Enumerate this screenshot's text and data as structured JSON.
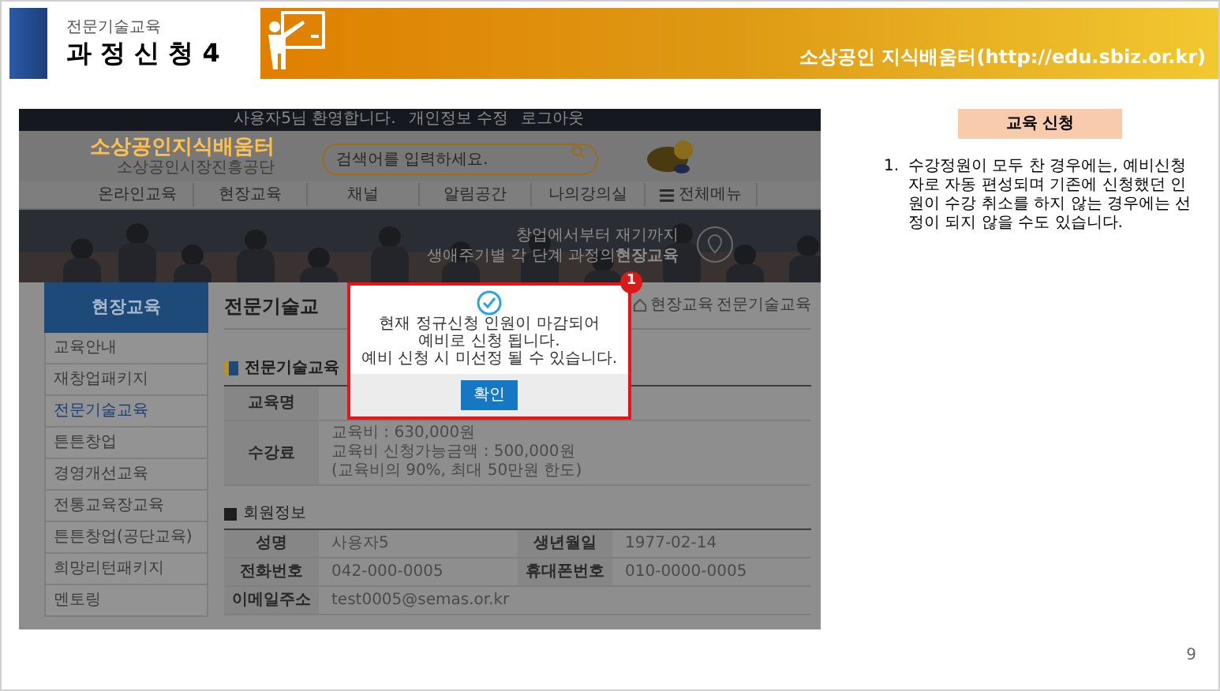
{
  "slide": {
    "subtitle": "전문기술교육",
    "title": "과 정 신 청 4",
    "site": "소상공인 지식배움터(http://edu.sbiz.or.kr)",
    "page_number": "9"
  },
  "screenshot": {
    "top_links": [
      "사용자5님 환영합니다.",
      "개인정보 수정",
      "로그아웃"
    ],
    "logo": "소상공인지식배움터",
    "logo_sub": "소상공인시장진흥공단",
    "search": {
      "placeholder": "검색어를 입력하세요."
    },
    "nav": [
      {
        "label": "온라인교육",
        "kind": "link"
      },
      {
        "label": "현장교육",
        "kind": "link"
      },
      {
        "label": "채널",
        "kind": "link"
      },
      {
        "label": "알림공간",
        "kind": "link"
      },
      {
        "label": "나의강의실",
        "kind": "link"
      },
      {
        "label": "전체메뉴",
        "kind": "menu"
      }
    ],
    "banner": {
      "line_1": "창업에서부터 재기까지",
      "line_2": "생애주기별 각 단계 과정의**현장교육**"
    },
    "side_title": "현장교육",
    "side_menu": [
      {
        "label": "교육안내",
        "selected": false
      },
      {
        "label": "재창업패키지",
        "selected": false
      },
      {
        "label": "전문기술교육",
        "selected": true
      },
      {
        "label": "튼튼창업",
        "selected": false
      },
      {
        "label": "경영개선교육",
        "selected": false
      },
      {
        "label": "전통교육장교육",
        "selected": false
      },
      {
        "label": "튼튼창업(공단교육)",
        "selected": false
      },
      {
        "label": "희망리턴패키지",
        "selected": false
      },
      {
        "label": "멘토링",
        "selected": false
      }
    ],
    "page_title": "전문기술교",
    "breadcrumb": [
      "현장교육",
      "전문기술교육"
    ],
    "course_section": {
      "heading": "전문기술교육",
      "rows": [
        {
          "label": "교육명",
          "lines": []
        },
        {
          "label": "수강료",
          "lines": [
            "교육비 : 630,000원",
            "교육비 신청가능금액 : 500,000원",
            "(교육비의 90%, 최대 50만원 한도)"
          ]
        }
      ]
    },
    "member_section": {
      "heading": "회원정보",
      "rows": [
        [
          {
            "label": "성명",
            "value": "사용자5"
          },
          {
            "label": "생년월일",
            "value": "1977-02-14"
          }
        ],
        [
          {
            "label": "전화번호",
            "value": "042-000-0005"
          },
          {
            "label": "휴대폰번호",
            "value": "010-0000-0005"
          }
        ],
        [
          {
            "label": "이메일주소",
            "value": "test0005@semas.or.kr"
          }
        ]
      ]
    },
    "dialog": {
      "lines": [
        "현재 정규신청 인원이 마감되어",
        "예비로 신청 됩니다.",
        "예비 신청 시 미선정 될 수 있습니다."
      ],
      "button": "확인",
      "badge": "1"
    }
  },
  "notes": {
    "heading": "교육 신청",
    "items": [
      {
        "number": "1.",
        "text": "수강정원이 모두 찬 경우에는, 예비신청자로 자동 편성되며 기존에 신청했던 인원이 수강 취소를 하지 않는 경우에는 선정이 되지 않을 수도 있습니다."
      }
    ]
  }
}
